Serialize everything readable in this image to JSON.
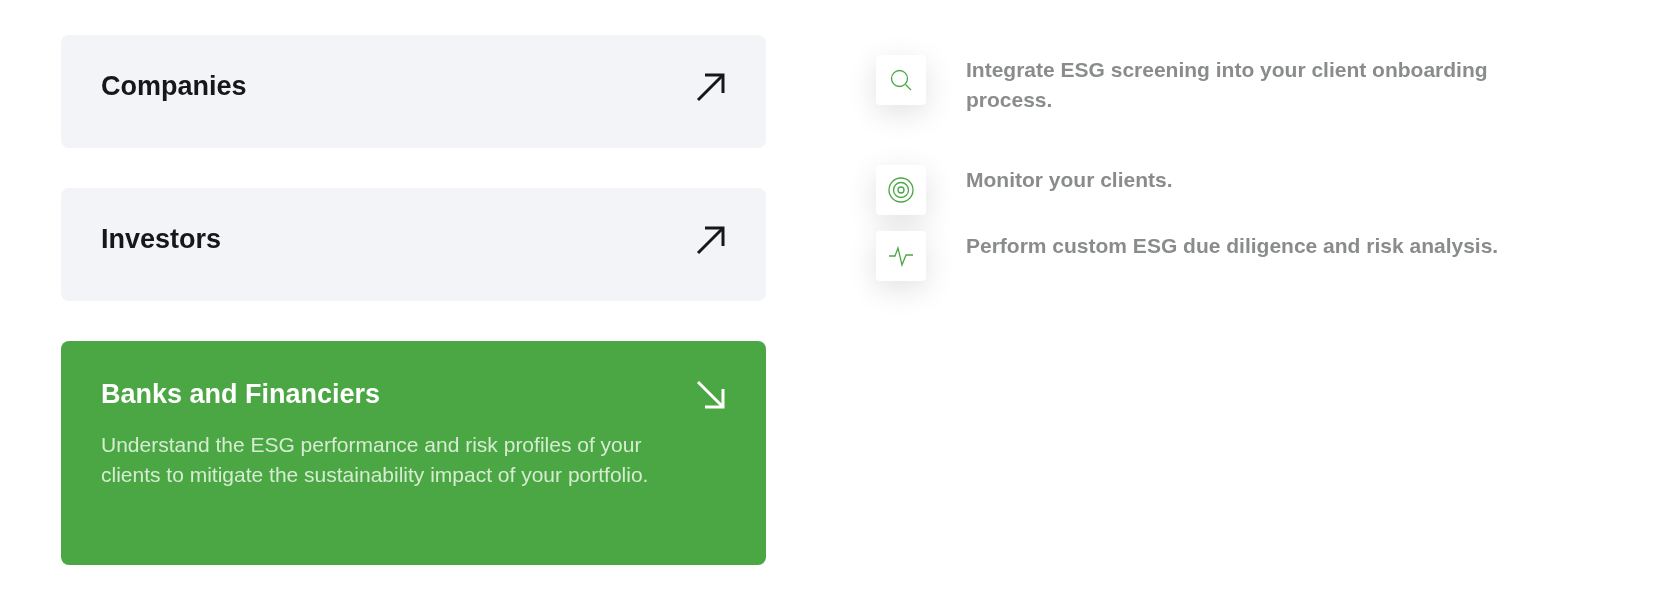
{
  "audiences": [
    {
      "title": "Companies",
      "selected": false
    },
    {
      "title": "Investors",
      "selected": false
    },
    {
      "title": "Banks and Financiers",
      "selected": true,
      "description": "Understand the ESG performance and risk profiles of your clients to mitigate the sustainability impact of your portfolio."
    }
  ],
  "features": [
    {
      "kind": "search",
      "text": "Integrate ESG screening into your client onboarding process."
    },
    {
      "kind": "target",
      "text": "Monitor your clients."
    },
    {
      "kind": "pulse",
      "text": "Perform custom ESG due diligence and risk analysis."
    }
  ]
}
